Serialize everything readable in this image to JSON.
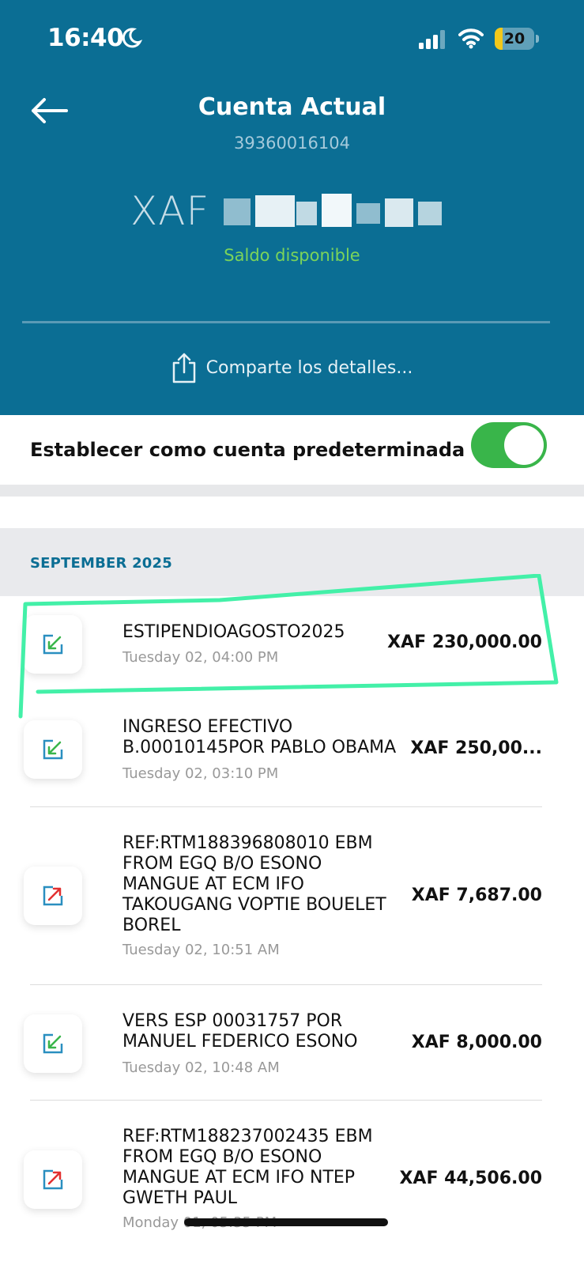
{
  "status_bar": {
    "time": "16:40",
    "battery": "20",
    "battery_level": 0.2,
    "icons": [
      "moon-icon",
      "signal-icon",
      "wifi-icon",
      "battery-icon"
    ]
  },
  "header": {
    "title": "Cuenta Actual",
    "account_number": "39360016104",
    "balance_currency": "XAF",
    "balance_label": "Saldo disponible",
    "share_label": "Comparte los detalles...",
    "background_color": "#0b6e94"
  },
  "default_account": {
    "label": "Establecer como cuenta predeterminada",
    "enabled": true,
    "toggle_color": "#39b54a"
  },
  "month": "SEPTEMBER 2025",
  "transactions": [
    {
      "direction": "incoming",
      "description": [
        "ESTIPENDIOAGOSTO2025"
      ],
      "date": "Tuesday 02, 04:00 PM",
      "amount": "XAF 230,000.00"
    },
    {
      "direction": "incoming",
      "description": [
        "INGRESO EFECTIVO",
        "B.00010145POR PABLO OBAMA"
      ],
      "date": "Tuesday 02, 03:10 PM",
      "amount": "XAF 250,00..."
    },
    {
      "direction": "outgoing",
      "description": [
        "REF:RTM188396808010 EBM",
        "FROM EGQ B/O ESONO",
        "MANGUE AT ECM IFO",
        "TAKOUGANG VOPTIE BOUELET",
        "BOREL"
      ],
      "date": "Tuesday 02, 10:51 AM",
      "amount": "XAF 7,687.00"
    },
    {
      "direction": "incoming",
      "description": [
        "VERS ESP 00031757 POR",
        "MANUEL FEDERICO ESONO"
      ],
      "date": "Tuesday 02, 10:48 AM",
      "amount": "XAF 8,000.00"
    },
    {
      "direction": "outgoing",
      "description": [
        "REF:RTM188237002435 EBM",
        "FROM EGQ B/O ESONO",
        "MANGUE AT ECM IFO  NTEP",
        "GWETH PAUL"
      ],
      "date": "Monday 01, 05:35 PM",
      "amount": "XAF 44,506.00"
    }
  ],
  "colors": {
    "incoming_arrow": "#39b54a",
    "outgoing_arrow": "#e23030",
    "icon_frame": "#2a8fc0",
    "highlight": "#43f0a8"
  }
}
